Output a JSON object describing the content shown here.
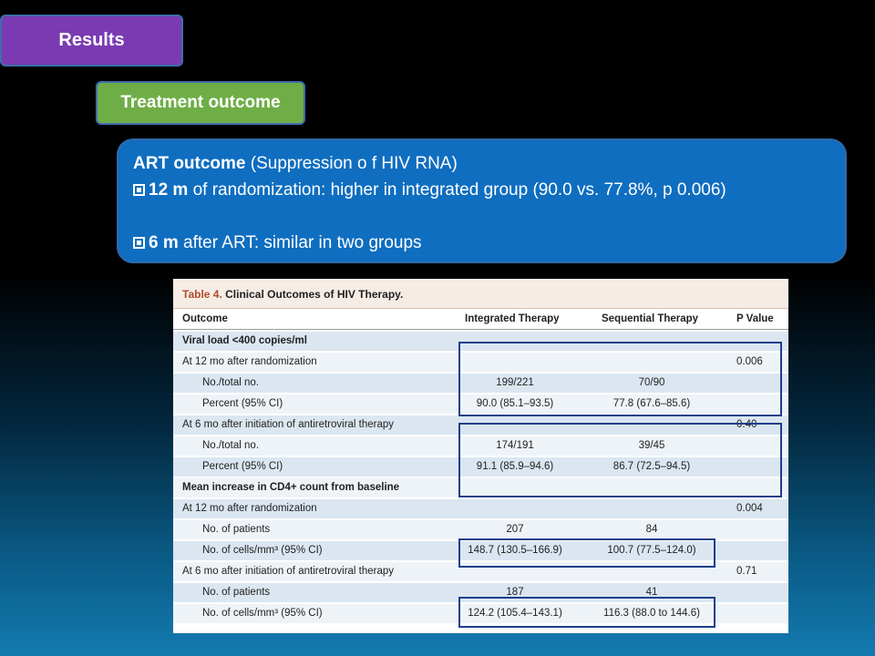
{
  "results_label": "Results",
  "treatment_label": "Treatment outcome",
  "summary": {
    "line1_bold": "ART outcome",
    "line1_rest": " (Suppression o f HIV RNA)",
    "bullet1_bold": "12 m",
    "bullet1_rest": " of randomization: higher in integrated group (90.0 vs. 77.8%, p 0.006)",
    "bullet2_bold": "6  m",
    "bullet2_rest": " after ART: similar in two groups"
  },
  "table": {
    "title_label": "Table 4.",
    "title_text": " Clinical Outcomes of HIV Therapy.",
    "headers": [
      "Outcome",
      "Integrated Therapy",
      "Sequential Therapy",
      "P Value"
    ],
    "rows": [
      {
        "c0": "Viral load <400 copies/ml",
        "c1": "",
        "c2": "",
        "c3": "",
        "indent": false,
        "bold": true,
        "style": "alt"
      },
      {
        "c0": "At 12 mo after randomization",
        "c1": "",
        "c2": "",
        "c3": "0.006",
        "indent": false,
        "bold": false,
        "style": "plain"
      },
      {
        "c0": "No./total no.",
        "c1": "199/221",
        "c2": "70/90",
        "c3": "",
        "indent": true,
        "bold": false,
        "style": "alt"
      },
      {
        "c0": "Percent (95% CI)",
        "c1": "90.0 (85.1–93.5)",
        "c2": "77.8 (67.6–85.6)",
        "c3": "",
        "indent": true,
        "bold": false,
        "style": "plain"
      },
      {
        "c0": "At 6 mo after initiation of antiretroviral therapy",
        "c1": "",
        "c2": "",
        "c3": "0.40",
        "indent": false,
        "bold": false,
        "style": "alt"
      },
      {
        "c0": "No./total no.",
        "c1": "174/191",
        "c2": "39/45",
        "c3": "",
        "indent": true,
        "bold": false,
        "style": "plain"
      },
      {
        "c0": "Percent (95% CI)",
        "c1": "91.1 (85.9–94.6)",
        "c2": "86.7 (72.5–94.5)",
        "c3": "",
        "indent": true,
        "bold": false,
        "style": "alt"
      },
      {
        "c0": "Mean increase in CD4+ count from baseline",
        "c1": "",
        "c2": "",
        "c3": "",
        "indent": false,
        "bold": true,
        "style": "plain"
      },
      {
        "c0": "At 12 mo after randomization",
        "c1": "",
        "c2": "",
        "c3": "0.004",
        "indent": false,
        "bold": false,
        "style": "alt"
      },
      {
        "c0": "No. of patients",
        "c1": "207",
        "c2": "84",
        "c3": "",
        "indent": true,
        "bold": false,
        "style": "plain"
      },
      {
        "c0": "No. of cells/mm³ (95% CI)",
        "c1": "148.7 (130.5–166.9)",
        "c2": "100.7 (77.5–124.0)",
        "c3": "",
        "indent": true,
        "bold": false,
        "style": "alt"
      },
      {
        "c0": "At 6 mo after initiation of antiretroviral therapy",
        "c1": "",
        "c2": "",
        "c3": "0.71",
        "indent": false,
        "bold": false,
        "style": "plain"
      },
      {
        "c0": "No. of patients",
        "c1": "187",
        "c2": "41",
        "c3": "",
        "indent": true,
        "bold": false,
        "style": "alt"
      },
      {
        "c0": "No. of cells/mm³ (95% CI)",
        "c1": "124.2 (105.4–143.1)",
        "c2": "116.3 (88.0 to 144.6)",
        "c3": "",
        "indent": true,
        "bold": false,
        "style": "plain"
      }
    ]
  },
  "colors": {
    "results_bg": "#7a3bb2",
    "treatment_bg": "#6fae47",
    "summary_bg": "#0f6ec0",
    "highlight_border": "#1c3f8a"
  }
}
